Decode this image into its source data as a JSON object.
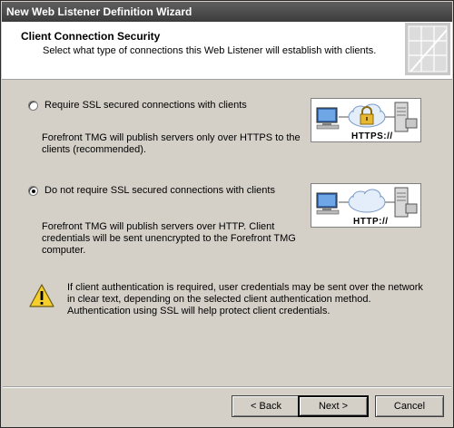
{
  "window": {
    "title": "New Web Listener Definition Wizard"
  },
  "header": {
    "title": "Client Connection Security",
    "subtitle": "Select what type of connections this Web Listener will establish with clients."
  },
  "options": [
    {
      "label": "Require SSL secured connections with clients",
      "description": "Forefront TMG will publish servers only over HTTPS to the clients (recommended).",
      "checked": false,
      "graphic_label": "HTTPS://",
      "graphic_icon": "lock-icon"
    },
    {
      "label": "Do not require SSL secured connections with clients",
      "description": "Forefront TMG will publish servers over HTTP. Client credentials will be sent unencrypted to the Forefront TMG computer.",
      "checked": true,
      "graphic_label": "HTTP://",
      "graphic_icon": "cloud-icon"
    }
  ],
  "warning": {
    "icon": "warning-icon",
    "text": "If client authentication is required, user credentials may be sent over the network in clear text, depending on the selected client authentication method. Authentication using SSL will help protect client credentials."
  },
  "buttons": {
    "back": "< Back",
    "next": "Next >",
    "cancel": "Cancel"
  },
  "colors": {
    "titlebar": "#4a4a4a",
    "dialog_bg": "#d4d0c8",
    "header_bg": "#ffffff"
  }
}
